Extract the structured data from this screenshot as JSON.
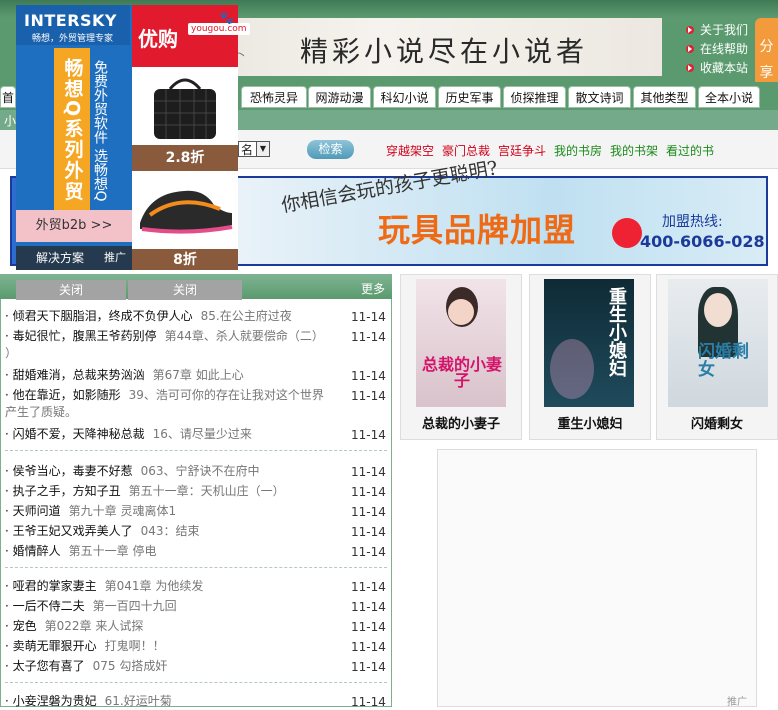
{
  "header": {
    "banner_slogan": "精彩小说尽在小说者",
    "top_links": [
      "关于我们",
      "在线帮助",
      "收藏本站"
    ],
    "share_label": "分享"
  },
  "nav": {
    "tabs": [
      "首",
      "恐怖灵异",
      "网游动漫",
      "科幻小说",
      "历史军事",
      "侦探推理",
      "散文诗词",
      "其他类型",
      "全本小说"
    ],
    "subnav_text": "小"
  },
  "search": {
    "select_value": "名",
    "button_label": "检索",
    "links": [
      {
        "label": "穿越架空",
        "color": "#d0021b"
      },
      {
        "label": "豪门总裁",
        "color": "#d0021b"
      },
      {
        "label": "宫廷争斗",
        "color": "#d0021b"
      },
      {
        "label": "我的书房",
        "color": "#1a8a1a"
      },
      {
        "label": "我的书架",
        "color": "#1a8a1a"
      },
      {
        "label": "看过的书",
        "color": "#1a8a1a"
      }
    ]
  },
  "ad_banner": {
    "question": "你相信会玩的孩子更聪明?",
    "brand": "玩具品牌加盟",
    "hotline_label": "加盟热线:",
    "phone": "400-6066-028"
  },
  "floating_ad": {
    "logo_brand": "INTERSKY",
    "logo_sub": "畅想，外贸管理专家",
    "vertical_text": "畅想Q系列外贸",
    "vertical_text2": "免费外贸软件 选畅想Q",
    "b2b_label": "外贸b2b >>",
    "solution_label": "解决方案",
    "promo_tag": "推广",
    "shop_logo": "优购",
    "shop_domain": "yougou.com",
    "discount1": "2.8折",
    "discount2": "8折"
  },
  "list": {
    "tabs": [
      "关闭",
      "关闭"
    ],
    "more_label": "更多",
    "groups": [
      [
        {
          "title": "· 倾君天下胭脂泪，终成不负伊人心",
          "chapter": "85.在公主府过夜",
          "date": "11-14"
        },
        {
          "title": "· 毒妃很忙，腹黑王爷药别停",
          "chapter": "第44章、杀人就要偿命（二）",
          "date": "11-14",
          "wrap": "）"
        },
        {
          "title": "· 甜婚难消，总裁来势汹汹",
          "chapter": "第67章 如此上心",
          "date": "11-14"
        },
        {
          "title": "· 他在靠近，如影随形",
          "chapter": "39、浩可可你的存在让我对这个世界",
          "date": "11-14",
          "wrap": "产生了质疑。"
        },
        {
          "title": "· 闪婚不爱，天降神秘总裁",
          "chapter": "16、请尽量少过来",
          "date": "11-14"
        }
      ],
      [
        {
          "title": "· 侯爷当心，毒妻不好惹",
          "chapter": "063、宁舒诀不在府中",
          "date": "11-14"
        },
        {
          "title": "· 执子之手，方知子丑",
          "chapter": "第五十一章：天机山庄（一）",
          "date": "11-14"
        },
        {
          "title": "· 天师问道",
          "chapter": "第九十章 灵魂离体1",
          "date": "11-14"
        },
        {
          "title": "· 王爷王妃又戏弄美人了",
          "chapter": "043：结束",
          "date": "11-14"
        },
        {
          "title": "· 婚情醉人",
          "chapter": "第五十一章 停电",
          "date": "11-14"
        }
      ],
      [
        {
          "title": "· 哑君的掌家妻主",
          "chapter": "第041章 为他续发",
          "date": "11-14"
        },
        {
          "title": "· 一后不侍二夫",
          "chapter": "第一百四十九回",
          "date": "11-14"
        },
        {
          "title": "· 宠色",
          "chapter": "第022章 来人试探",
          "date": "11-14"
        },
        {
          "title": "· 卖萌无罪狠开心",
          "chapter": "打鬼啊！！",
          "date": "11-14"
        },
        {
          "title": "· 太子您有喜了",
          "chapter": "075 勾搭成奸",
          "date": "11-14"
        }
      ],
      [
        {
          "title": "· 小妾涅磐为贵妃",
          "chapter": "61.好运叶菊",
          "date": "11-14"
        }
      ]
    ]
  },
  "books": [
    {
      "title": "总裁的小妻子",
      "cover_text": "总裁的小妻子",
      "color": "#e8d4d8"
    },
    {
      "title": "重生小媳妇",
      "cover_text": "重生小媳妇",
      "color": "#1b3b4a"
    },
    {
      "title": "闪婚剩女",
      "cover_text": "闪婚剩女",
      "color": "#3f5d6f"
    }
  ],
  "promo_label": "推广"
}
